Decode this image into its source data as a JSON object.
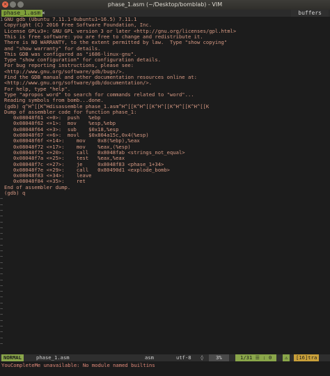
{
  "window": {
    "title": "phase_1.asm (~/Desktop/bomblab) - VIM",
    "close_glyph": "×"
  },
  "tabline": {
    "active_tab": "phase_1.asm",
    "close_glyph": "×",
    "buffers_label": "buffers"
  },
  "editor": {
    "line_number": "1",
    "lines": [
      "GNU gdb (Ubuntu 7.11.1-0ubuntu1~16.5) 7.11.1",
      "Copyright (C) 2016 Free Software Foundation, Inc.",
      "License GPLv3+: GNU GPL version 3 or later <http://gnu.org/licenses/gpl.html>",
      "This is free software: you are free to change and redistribute it.",
      "There is NO WARRANTY, to the extent permitted by law.  Type \"show copying\"",
      "and \"show warranty\" for details.",
      "This GDB was configured as \"i686-linux-gnu\".",
      "Type \"show configuration\" for configuration details.",
      "For bug reporting instructions, please see:",
      "<http://www.gnu.org/software/gdb/bugs/>.",
      "Find the GDB manual and other documentation resources online at:",
      "<http://www.gnu.org/software/gdb/documentation/>.",
      "For help, type \"help\".",
      "Type \"apropos word\" to search for commands related to \"word\"...",
      "Reading symbols from bomb...done.",
      "(gdb) q^H^[[K^Hdisassemble phase_1.asm^H^[[K^H^[[K^H^[[K^H^[[K^H^[[K",
      "Dump of assembler code for function phase_1:",
      "   0x08048f61 <+0>:  push   %ebp",
      "   0x08048f62 <+1>:  mov    %esp,%ebp",
      "   0x08048f64 <+3>:  sub    $0x18,%esp",
      "   0x08048f67 <+6>:  movl   $0x804a15c,0x4(%esp)",
      "   0x08048f6f <+14>:    mov    0x8(%ebp),%eax",
      "   0x08048f72 <+17>:    mov    %eax,(%esp)",
      "   0x08048f75 <+20>:    call   0x8048fab <strings_not_equal>",
      "   0x08048f7a <+25>:    test   %eax,%eax",
      "   0x08048f7c <+27>:    je     0x8048f83 <phase_1+34>",
      "   0x08048f7e <+29>:    call   0x80490d1 <explode_bomb>",
      "   0x08048f83 <+34>:    leave",
      "   0x08048f84 <+35>:    ret",
      "End of assembler dump.",
      "(gdb) q"
    ],
    "tilde": "~",
    "empty_line_count": 26
  },
  "statusline": {
    "mode": "NORMAL",
    "filename": "phase_1.asm",
    "filetype": "asm",
    "encoding": "utf-8",
    "os_icon": "◊",
    "percent": "3%",
    "position": "1/31 ☰ : 0",
    "warning_icon": "⚠",
    "trailing": "[16]tra"
  },
  "cmdline": {
    "message": "YouCompleteMe unavailable: No module named builtins"
  },
  "colors": {
    "green": "#8aa64a",
    "text": "#d89a84",
    "background": "#1c1c1c"
  }
}
